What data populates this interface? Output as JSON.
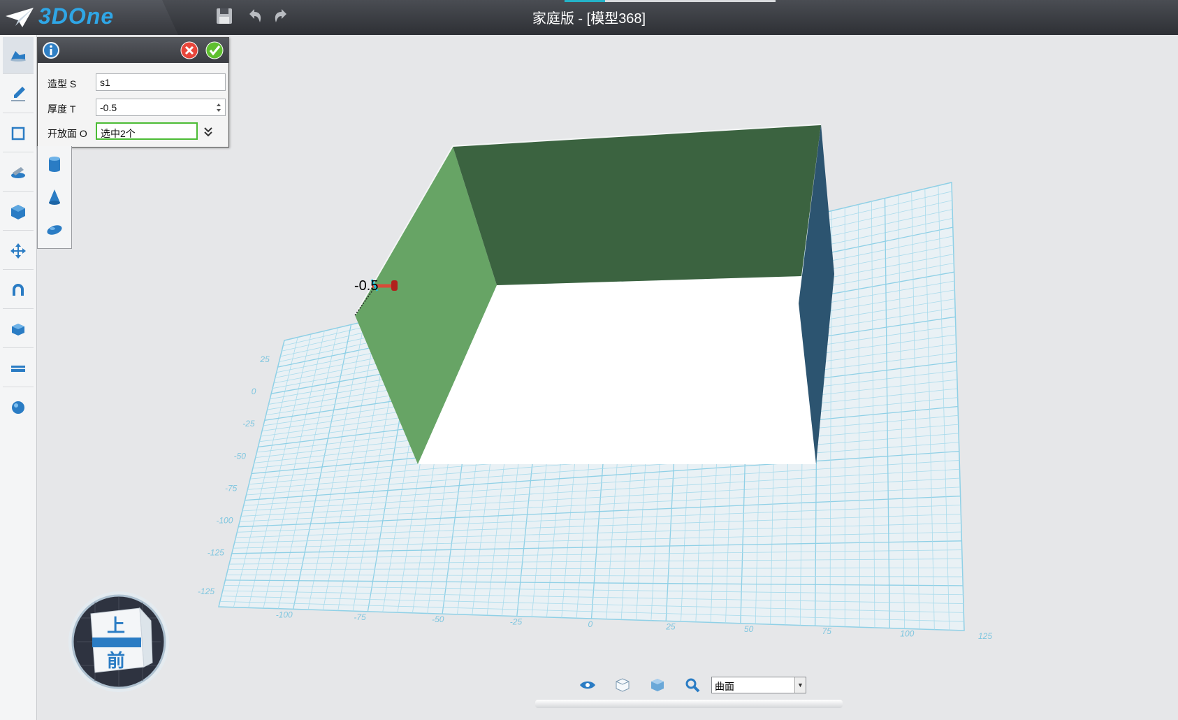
{
  "app": {
    "logo": "3DOne",
    "title": "家庭版 - [模型368]",
    "accent_color": "#24b3c8"
  },
  "titlebar": {
    "icons": [
      "save-icon",
      "undo-icon",
      "redo-icon"
    ]
  },
  "left_toolbar": {
    "items": [
      {
        "name": "basic-shapes-icon"
      },
      {
        "name": "sketch-icon"
      },
      {
        "name": "sketch-edit-icon"
      },
      {
        "name": "feature-icon"
      },
      {
        "name": "special-feature-icon"
      },
      {
        "name": "transform-icon"
      },
      {
        "name": "assembly-icon"
      },
      {
        "name": "combine-icon"
      },
      {
        "name": "measure-icon"
      },
      {
        "name": "render-icon"
      }
    ]
  },
  "panel": {
    "info_icon": "info-icon",
    "fields": [
      {
        "label": "造型 S",
        "value": "s1"
      },
      {
        "label": "厚度 T",
        "value": "-0.5"
      },
      {
        "label": "开放面 O",
        "value": "选中2个"
      }
    ]
  },
  "sub_toolbar": {
    "items": [
      "cylinder-icon",
      "cone-icon",
      "ellipsoid-icon"
    ]
  },
  "viewport": {
    "dimension_label": "-0.5",
    "grid_color": "#8fd0e6",
    "left_face_color": "#67a465",
    "back_face_color": "#3b6340",
    "right_face_color": "#2c5470",
    "grid_x_labels": [
      "-125",
      "-100",
      "-75",
      "-50",
      "-25",
      "0",
      "25",
      "50",
      "75",
      "100",
      "125"
    ],
    "grid_y_labels": [
      "25",
      "0",
      "-25",
      "-50",
      "-75",
      "-100",
      "-125"
    ]
  },
  "view_cube": {
    "top_label": "上",
    "front_label": "前"
  },
  "bottom_bar": {
    "icons": [
      "eye-icon",
      "wireframe-cube-icon",
      "solid-cube-icon",
      "zoom-icon"
    ],
    "filter_value": "曲面"
  }
}
